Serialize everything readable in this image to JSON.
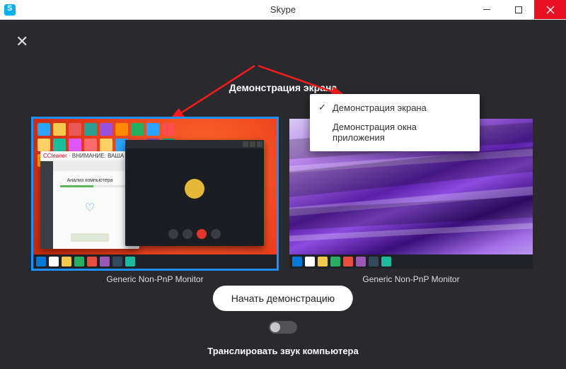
{
  "window": {
    "title": "Skype"
  },
  "heading": "Демонстрация экрана",
  "menu": {
    "items": [
      {
        "label": "Демонстрация экрана",
        "checked": true
      },
      {
        "label": "Демонстрация окна приложения",
        "checked": false
      }
    ]
  },
  "monitors": [
    {
      "label": "Generic Non-PnP Monitor",
      "selected": true
    },
    {
      "label": "Generic Non-PnP Monitor",
      "selected": false
    }
  ],
  "startButton": "Начать демонстрацию",
  "audioLabel": "Транслировать звук компьютера",
  "thumb1": {
    "stripPrefix": "CCleaner",
    "stripSuffix": " · ВНИМАНИЕ: ВАША КОНФИДЕНЦИАЛЬНОСТЬ ПОД…",
    "analysisLabel": "Анализ компьютера"
  },
  "iconColors": [
    "#2aa3ff",
    "#f2c94c",
    "#eb5757",
    "#2a9d8f",
    "#9b51e0",
    "#ff8a00",
    "#27ae60",
    "#2aa3ff",
    "#ff4d4d",
    "#ffd166",
    "#1abc9c",
    "#e056fd",
    "#ff6b6b",
    "#ffd166",
    "#2aa3ff",
    "#e74c3c",
    "#8e44ad",
    "#16a085",
    "#f39c12",
    "#2980b9",
    "#27ae60",
    "#c0392b"
  ],
  "taskbarColors": [
    "#0078d7",
    "#fff",
    "#f2c94c",
    "#27ae60",
    "#e74c3c",
    "#9b59b6",
    "#34495e",
    "#1abc9c"
  ]
}
